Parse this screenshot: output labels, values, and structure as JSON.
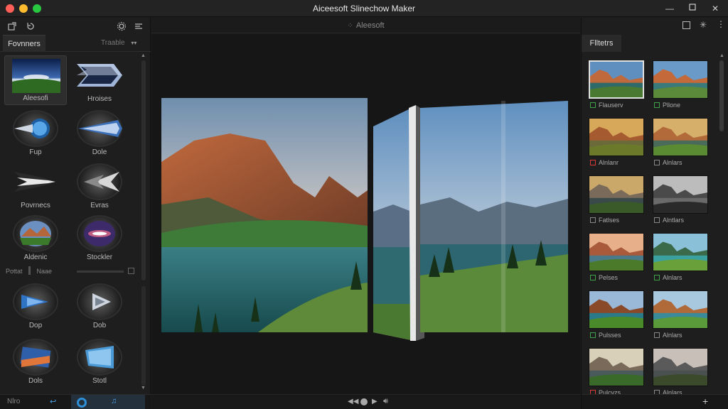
{
  "window": {
    "title": "Aiceesoft Slinechow Maker"
  },
  "left_panel": {
    "tabs": {
      "active": "Fovnners",
      "inactive": "Traable"
    },
    "transitions": [
      {
        "label": "Aleesofi"
      },
      {
        "label": "Hroises"
      },
      {
        "label": "Fup"
      },
      {
        "label": "Dole"
      },
      {
        "label": "Povrnecs"
      },
      {
        "label": "Evras"
      },
      {
        "label": "Aldenic"
      },
      {
        "label": "Stockler"
      },
      {
        "label": "Dop"
      },
      {
        "label": "Dob"
      },
      {
        "label": "Dols"
      },
      {
        "label": "Stotl"
      }
    ],
    "property_row": {
      "label1": "Pottat",
      "label2": "Naae"
    },
    "bottom_label": "Nlro"
  },
  "center": {
    "header": "Aleesoft"
  },
  "right_panel": {
    "tab": "Flltetrs",
    "filters": [
      {
        "label": "Flauserv"
      },
      {
        "label": "Pllone"
      },
      {
        "label": "Alnlanr"
      },
      {
        "label": "Alnlars"
      },
      {
        "label": "Fatlses"
      },
      {
        "label": "Alntlars"
      },
      {
        "label": "Pelses"
      },
      {
        "label": "Alnlars"
      },
      {
        "label": "Pulsses"
      },
      {
        "label": "Alnlars"
      },
      {
        "label": "Pulcvzs"
      },
      {
        "label": "Alnlars"
      }
    ]
  },
  "colors": {
    "background": "#1c1c1c",
    "panel": "#1e1e1e",
    "check_green": "#3fa14a",
    "check_red": "#d83a3a",
    "accent_blue": "#2f8fd6"
  }
}
